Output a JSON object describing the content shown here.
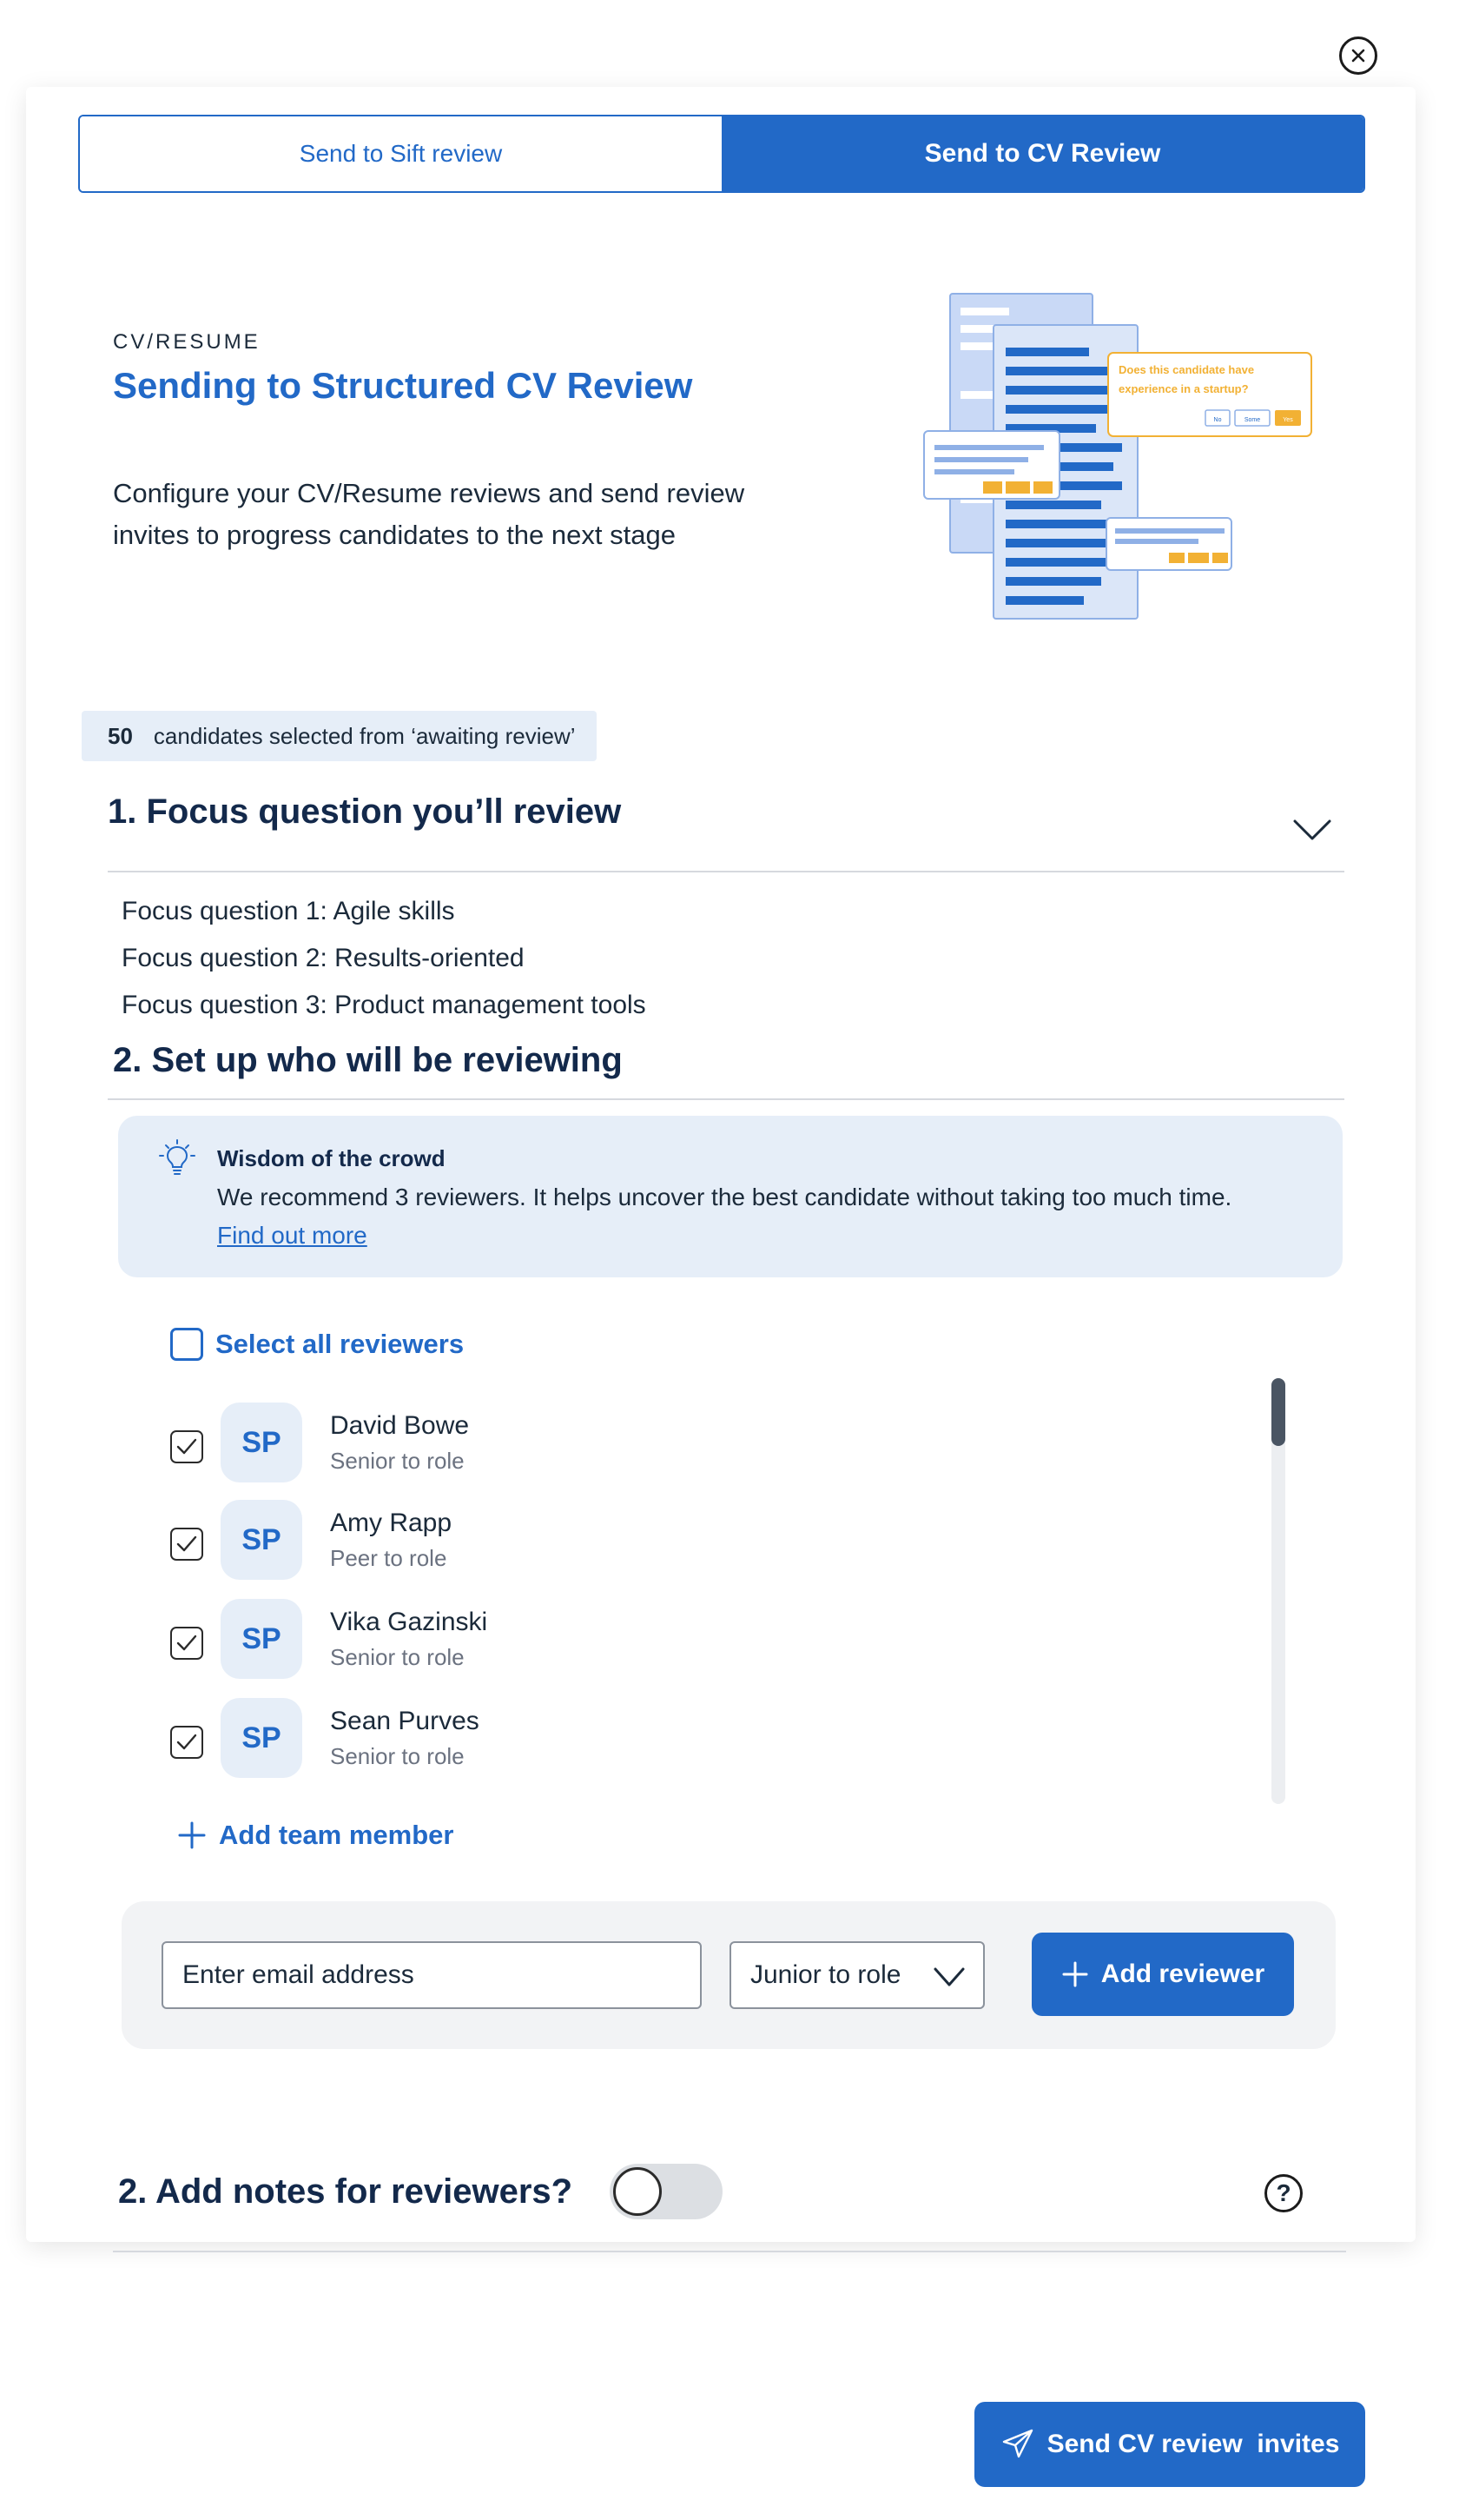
{
  "tabs": {
    "sift": "Send to Sift review",
    "cv": "Send to CV Review"
  },
  "header": {
    "eyebrow": "CV/RESUME",
    "title": "Sending to Structured CV Review",
    "intro": "Configure your CV/Resume reviews and send review invites to progress candidates to the next stage"
  },
  "illustration": {
    "question": "Does this candidate have experience in a startup?",
    "options": [
      "No",
      "Some",
      "Yes"
    ]
  },
  "selection": {
    "count": "50",
    "text": "candidates selected from ‘awaiting review’"
  },
  "focus": {
    "title": "1. Focus question you’ll review",
    "questions": [
      "Focus question 1: Agile skills",
      "Focus question 2: Results-oriented",
      "Focus question 3: Product management tools"
    ]
  },
  "reviewing": {
    "title": "2. Set up who will be reviewing",
    "tip": {
      "title": "Wisdom of the crowd",
      "body": "We recommend 3 reviewers. It helps uncover the best candidate without taking too much time.",
      "link": "Find out more"
    },
    "select_all": "Select all reviewers",
    "reviewers": [
      {
        "initials": "SP",
        "name": "David Bowe",
        "role": "Senior to role",
        "checked": true
      },
      {
        "initials": "SP",
        "name": "Amy Rapp",
        "role": "Peer to role",
        "checked": true
      },
      {
        "initials": "SP",
        "name": "Vika Gazinski",
        "role": "Senior to role",
        "checked": true
      },
      {
        "initials": "SP",
        "name": "Sean Purves",
        "role": "Senior to role",
        "checked": true
      }
    ],
    "add_team_member": "Add team member",
    "email_placeholder": "Enter email address",
    "role_selected": "Junior to role",
    "add_reviewer": "Add reviewer"
  },
  "notes": {
    "title": "2. Add notes for reviewers?",
    "enabled": false,
    "help": "?"
  },
  "send_button": "Send CV review  invites",
  "colors": {
    "primary": "#2269c7",
    "tint": "#e6eef8",
    "heading": "#13294b",
    "accent": "#f2b134"
  }
}
